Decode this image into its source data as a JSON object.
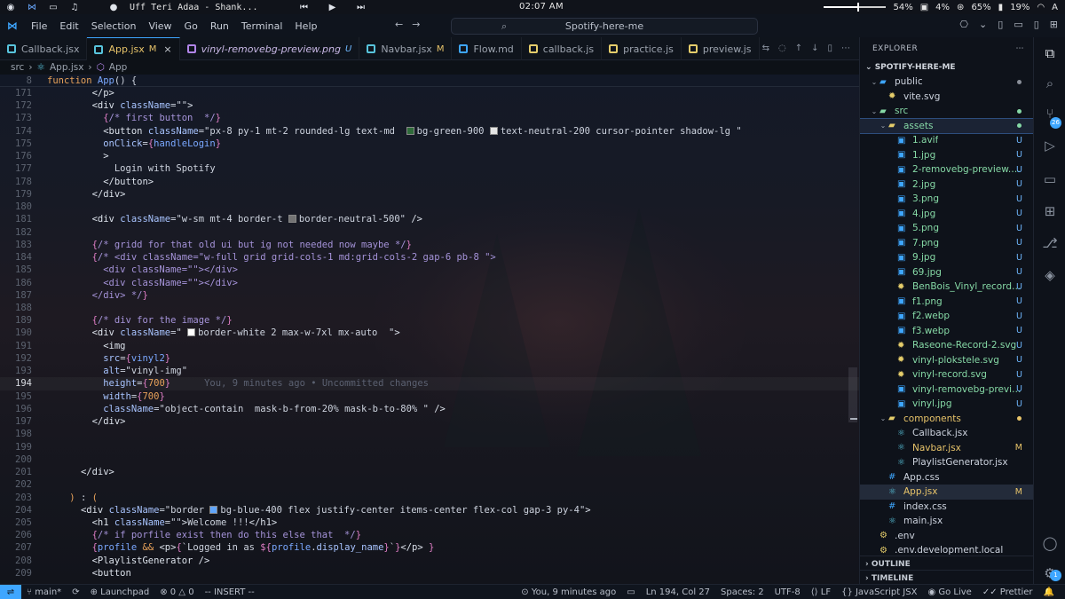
{
  "system": {
    "song": "Uff Teri Adaa - Shank...",
    "clock": "02:07 AM",
    "volume_level": 0.53,
    "volume_text": "54%",
    "cpu_text": "4%",
    "memory_text": "65%",
    "battery_text": "19%",
    "keyboard_layout": "A"
  },
  "titlebar": {
    "menus": [
      "File",
      "Edit",
      "Selection",
      "View",
      "Go",
      "Run",
      "Terminal",
      "Help"
    ],
    "command_center": "Spotify-here-me"
  },
  "tabs": [
    {
      "label": "Callback.jsx",
      "mod": "",
      "color": "#58c4dc"
    },
    {
      "label": "App.jsx",
      "mod": "M",
      "color": "#58c4dc",
      "active": true
    },
    {
      "label": "vinyl-removebg-preview.png",
      "mod": "U",
      "color": "#b084e8"
    },
    {
      "label": "Navbar.jsx",
      "mod": "M",
      "color": "#58c4dc"
    },
    {
      "label": "Flow.md",
      "mod": "",
      "color": "#3ea6ff"
    },
    {
      "label": "callback.js",
      "mod": "",
      "color": "#e5cd6b"
    },
    {
      "label": "practice.js",
      "mod": "",
      "color": "#e5cd6b"
    },
    {
      "label": "preview.js",
      "mod": "",
      "color": "#e5cd6b"
    }
  ],
  "breadcrumb": {
    "folder": "src",
    "file": "App.jsx",
    "symbol": "App"
  },
  "editor": {
    "sticky": {
      "num": "8",
      "keyword": "function",
      "name": "App",
      "rest": "() {"
    },
    "blame_inline": "You, 9 minutes ago • Uncommitted changes",
    "lines": [
      {
        "n": "171",
        "html": "        <span class='tag'>&lt;/p&gt;</span>"
      },
      {
        "n": "172",
        "html": "        <span class='tag'>&lt;div</span> <span class='attr'>className</span><span class='pl'>=</span><span class='str'>\"\"</span><span class='tag'>&gt;</span>"
      },
      {
        "n": "173",
        "html": "          <span class='br'>{</span><span class='cm'>/* first button  */</span><span class='br'>}</span>"
      },
      {
        "n": "174",
        "html": "          <span class='tag'>&lt;button</span> <span class='attr'>className</span><span class='pl'>=</span><span class='str'>\"px-8 py-1 mt-2 rounded-lg text-md  <span class='sw' style='background:#2f6b3a'></span>bg-green-900 <span class='sw' style='background:#e5e5e5'></span>text-neutral-200 cursor-pointer shadow-lg \"</span>"
      },
      {
        "n": "175",
        "html": "          <span class='attr'>onClick</span><span class='pl'>=</span><span class='br'>{</span><span class='fn'>handleLogin</span><span class='br'>}</span>"
      },
      {
        "n": "176",
        "html": "          <span class='tag'>&gt;</span>"
      },
      {
        "n": "177",
        "html": "            <span class='pl'>Login with Spotify</span>"
      },
      {
        "n": "178",
        "html": "          <span class='tag'>&lt;/button&gt;</span>"
      },
      {
        "n": "179",
        "html": "        <span class='tag'>&lt;/div&gt;</span>"
      },
      {
        "n": "180",
        "html": ""
      },
      {
        "n": "181",
        "html": "        <span class='tag'>&lt;div</span> <span class='attr'>className</span><span class='pl'>=</span><span class='str'>\"w-sm mt-4 border-t <span class='sw' style='background:#737373'></span>border-neutral-500\"</span> <span class='tag'>/&gt;</span>"
      },
      {
        "n": "182",
        "html": ""
      },
      {
        "n": "183",
        "html": "        <span class='br'>{</span><span class='cm'>/* gridd for that old ui but ig not needed now maybe */</span><span class='br'>}</span>"
      },
      {
        "n": "184",
        "html": "        <span class='br'>{</span><span class='cm'>/* &lt;div className=\"w-full grid grid-cols-1 md:grid-cols-2 gap-6 pb-8 \"&gt;</span>"
      },
      {
        "n": "185",
        "html": "<span class='cm'>          &lt;div className=\"\"&gt;&lt;/div&gt;</span>"
      },
      {
        "n": "186",
        "html": "<span class='cm'>          &lt;div className=\"\"&gt;&lt;/div&gt;</span>"
      },
      {
        "n": "187",
        "html": "<span class='cm'>        &lt;/div&gt; */</span><span class='br'>}</span>"
      },
      {
        "n": "188",
        "html": ""
      },
      {
        "n": "189",
        "html": "        <span class='br'>{</span><span class='cm'>/* div for the image */</span><span class='br'>}</span>"
      },
      {
        "n": "190",
        "html": "        <span class='tag'>&lt;div</span> <span class='attr'>className</span><span class='pl'>=</span><span class='str'>\" <span class='sw' style='background:#ffffff'></span>border-white 2 max-w-7xl mx-auto  \"</span><span class='tag'>&gt;</span>"
      },
      {
        "n": "191",
        "html": "          <span class='tag'>&lt;img</span>"
      },
      {
        "n": "192",
        "html": "          <span class='attr'>src</span><span class='pl'>=</span><span class='br'>{</span><span class='fn'>vinyl2</span><span class='br'>}</span>"
      },
      {
        "n": "193",
        "html": "          <span class='attr'>alt</span><span class='pl'>=</span><span class='str'>\"vinyl-img\"</span>"
      },
      {
        "n": "194",
        "html": "          <span class='attr'>height</span><span class='pl'>=</span><span class='br'>{</span><span class='kw'>700</span><span class='br'>}</span>",
        "cur": true
      },
      {
        "n": "195",
        "html": "          <span class='attr'>width</span><span class='pl'>=</span><span class='br'>{</span><span class='kw'>700</span><span class='br'>}</span>"
      },
      {
        "n": "196",
        "html": "          <span class='attr'>className</span><span class='pl'>=</span><span class='str'>\"object-contain  mask-b-from-20% mask-b-to-80% \"</span> <span class='tag'>/&gt;</span>"
      },
      {
        "n": "197",
        "html": "        <span class='tag'>&lt;/div&gt;</span>"
      },
      {
        "n": "198",
        "html": ""
      },
      {
        "n": "199",
        "html": ""
      },
      {
        "n": "200",
        "html": ""
      },
      {
        "n": "201",
        "html": "      <span class='tag'>&lt;/div&gt;</span>"
      },
      {
        "n": "202",
        "html": ""
      },
      {
        "n": "203",
        "html": "    <span class='kw'>)</span> <span class='pl'>:</span> <span class='kw'>(</span>"
      },
      {
        "n": "204",
        "html": "      <span class='tag'>&lt;div</span> <span class='attr'>className</span><span class='pl'>=</span><span class='str'>\"border <span class='sw' style='background:#60a5fa'></span>bg-blue-400 flex justify-center items-center flex-col gap-3 py-4\"</span><span class='tag'>&gt;</span>"
      },
      {
        "n": "205",
        "html": "        <span class='tag'>&lt;h1</span> <span class='attr'>className</span><span class='pl'>=</span><span class='str'>\"\"</span><span class='tag'>&gt;</span><span class='pl'>Welcome !!!</span><span class='tag'>&lt;/h1&gt;</span>"
      },
      {
        "n": "206",
        "html": "        <span class='br'>{</span><span class='cm'>/* if porfile exist then do this else that  */</span><span class='br'>}</span>"
      },
      {
        "n": "207",
        "html": "        <span class='br'>{</span><span class='fn'>profile</span> <span class='kw'>&amp;&amp;</span> <span class='tag'>&lt;p&gt;</span><span class='br'>{</span><span class='str'>`Logged in as </span><span class='br'>${</span><span class='fn'>profile</span><span class='pl'>.</span><span class='attr'>display_name</span><span class='br'>}</span><span class='str'>`</span><span class='br'>}</span><span class='tag'>&lt;/p&gt;</span> <span class='br'>}</span>"
      },
      {
        "n": "208",
        "html": "        <span class='tag'>&lt;PlaylistGenerator /&gt;</span>"
      },
      {
        "n": "209",
        "html": "        <span class='tag'>&lt;button</span>"
      }
    ]
  },
  "explorer": {
    "title": "EXPLORER",
    "project": "SPOTIFY-HERE-ME",
    "outline_label": "OUTLINE",
    "timeline_label": "TIMELINE",
    "items": [
      {
        "label": "public",
        "indent": 1,
        "type": "folder-open",
        "color": "#3ea6ff",
        "stat": "dot"
      },
      {
        "label": "vite.svg",
        "indent": 2,
        "type": "svg",
        "color": "#e5cd6b",
        "stat": ""
      },
      {
        "label": "src",
        "indent": 1,
        "type": "folder-open",
        "color": "#86d9a6",
        "stat": "dot",
        "labelcls": "col-green"
      },
      {
        "label": "assets",
        "indent": 2,
        "type": "folder-open",
        "color": "#e5cd6b",
        "stat": "dot",
        "labelcls": "col-green",
        "sel": true
      },
      {
        "label": "1.avif",
        "indent": 3,
        "type": "img",
        "color": "#3ea6ff",
        "stat": "U",
        "labelcls": "col-green"
      },
      {
        "label": "1.jpg",
        "indent": 3,
        "type": "img",
        "color": "#3ea6ff",
        "stat": "U",
        "labelcls": "col-green"
      },
      {
        "label": "2-removebg-preview.png",
        "indent": 3,
        "type": "img",
        "color": "#3ea6ff",
        "stat": "U",
        "labelcls": "col-green"
      },
      {
        "label": "2.jpg",
        "indent": 3,
        "type": "img",
        "color": "#3ea6ff",
        "stat": "U",
        "labelcls": "col-green"
      },
      {
        "label": "3.png",
        "indent": 3,
        "type": "img",
        "color": "#3ea6ff",
        "stat": "U",
        "labelcls": "col-green"
      },
      {
        "label": "4.jpg",
        "indent": 3,
        "type": "img",
        "color": "#3ea6ff",
        "stat": "U",
        "labelcls": "col-green"
      },
      {
        "label": "5.png",
        "indent": 3,
        "type": "img",
        "color": "#3ea6ff",
        "stat": "U",
        "labelcls": "col-green"
      },
      {
        "label": "7.png",
        "indent": 3,
        "type": "img",
        "color": "#3ea6ff",
        "stat": "U",
        "labelcls": "col-green"
      },
      {
        "label": "9.jpg",
        "indent": 3,
        "type": "img",
        "color": "#3ea6ff",
        "stat": "U",
        "labelcls": "col-green"
      },
      {
        "label": "69.jpg",
        "indent": 3,
        "type": "img",
        "color": "#3ea6ff",
        "stat": "U",
        "labelcls": "col-green"
      },
      {
        "label": "BenBois_Vinyl_records.s...",
        "indent": 3,
        "type": "svg",
        "color": "#e5cd6b",
        "stat": "U",
        "labelcls": "col-green"
      },
      {
        "label": "f1.png",
        "indent": 3,
        "type": "img",
        "color": "#3ea6ff",
        "stat": "U",
        "labelcls": "col-green"
      },
      {
        "label": "f2.webp",
        "indent": 3,
        "type": "img",
        "color": "#3ea6ff",
        "stat": "U",
        "labelcls": "col-green"
      },
      {
        "label": "f3.webp",
        "indent": 3,
        "type": "img",
        "color": "#3ea6ff",
        "stat": "U",
        "labelcls": "col-green"
      },
      {
        "label": "Raseone-Record-2.svg",
        "indent": 3,
        "type": "svg",
        "color": "#e5cd6b",
        "stat": "U",
        "labelcls": "col-green"
      },
      {
        "label": "vinyl-plokstele.svg",
        "indent": 3,
        "type": "svg",
        "color": "#e5cd6b",
        "stat": "U",
        "labelcls": "col-green"
      },
      {
        "label": "vinyl-record.svg",
        "indent": 3,
        "type": "svg",
        "color": "#e5cd6b",
        "stat": "U",
        "labelcls": "col-green"
      },
      {
        "label": "vinyl-removebg-preview....",
        "indent": 3,
        "type": "img",
        "color": "#3ea6ff",
        "stat": "U",
        "labelcls": "col-green"
      },
      {
        "label": "vinyl.jpg",
        "indent": 3,
        "type": "img",
        "color": "#3ea6ff",
        "stat": "U",
        "labelcls": "col-green"
      },
      {
        "label": "components",
        "indent": 2,
        "type": "folder-open",
        "color": "#e5cd6b",
        "stat": "dot",
        "labelcls": "col-orange"
      },
      {
        "label": "Callback.jsx",
        "indent": 3,
        "type": "react",
        "color": "#58c4dc",
        "stat": ""
      },
      {
        "label": "Navbar.jsx",
        "indent": 3,
        "type": "react",
        "color": "#58c4dc",
        "stat": "M",
        "labelcls": "col-orange"
      },
      {
        "label": "PlaylistGenerator.jsx",
        "indent": 3,
        "type": "react",
        "color": "#58c4dc",
        "stat": ""
      },
      {
        "label": "App.css",
        "indent": 2,
        "type": "css",
        "color": "#3ea6ff",
        "stat": ""
      },
      {
        "label": "App.jsx",
        "indent": 2,
        "type": "react",
        "color": "#58c4dc",
        "stat": "M",
        "labelcls": "col-orange",
        "active": true
      },
      {
        "label": "index.css",
        "indent": 2,
        "type": "css",
        "color": "#3ea6ff",
        "stat": ""
      },
      {
        "label": "main.jsx",
        "indent": 2,
        "type": "react",
        "color": "#58c4dc",
        "stat": ""
      },
      {
        "label": ".env",
        "indent": 1,
        "type": "env",
        "color": "#e5cd6b",
        "stat": ""
      },
      {
        "label": ".env.development.local",
        "indent": 1,
        "type": "env",
        "color": "#e5cd6b",
        "stat": ""
      }
    ]
  },
  "activity": {
    "scm_badge": "26",
    "account_badge": "1"
  },
  "status": {
    "branch": "main*",
    "launchpad": "Launchpad",
    "errors": "0",
    "warnings": "0",
    "mode": "-- INSERT --",
    "blame": "You, 9 minutes ago",
    "position": "Ln 194, Col 27",
    "spaces": "Spaces: 2",
    "encoding": "UTF-8",
    "eol": "LF",
    "language": "JavaScript JSX",
    "golive": "Go Live",
    "prettier": "Prettier"
  }
}
